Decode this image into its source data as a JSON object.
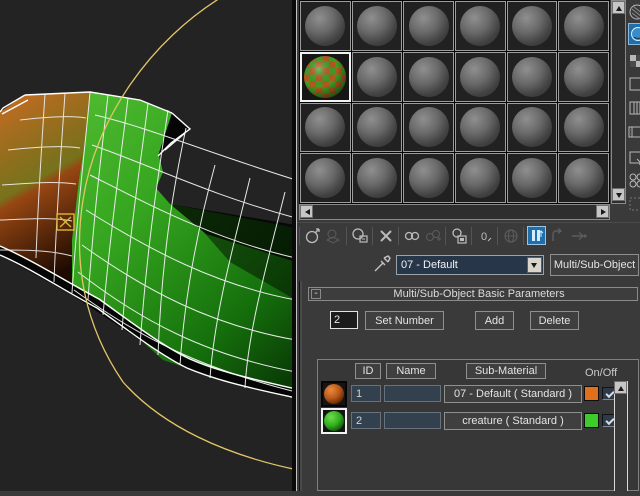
{
  "viewport": {
    "mesh": "creature-limb-mesh",
    "colors": {
      "green_material": "#3fbf28",
      "orange_material": "#c2651e",
      "wireframe": "#f2f2f2",
      "gizmo_yellow": "#e3c568",
      "background": "#232323"
    }
  },
  "material_editor": {
    "slots": {
      "rows": 4,
      "cols": 6,
      "selected_index": 6,
      "selected_slot_name": "multi-sub-object-checker-sphere"
    },
    "side_toolbar": {
      "icons": [
        "sample-type-icon",
        "backlight-icon",
        "background-icon",
        "sample-uv-tiling-icon",
        "video-color-check-icon",
        "make-preview-icon",
        "options-icon",
        "select-by-material-icon",
        "material-map-navigator-icon"
      ],
      "pressed": "backlight-icon",
      "pressed_color": "#1d6fae"
    },
    "toolbar": {
      "icons": [
        {
          "name": "get-material-icon",
          "enabled": true
        },
        {
          "name": "put-material-to-scene-icon",
          "enabled": false
        },
        {
          "name": "assign-material-to-selection-icon",
          "enabled": true
        },
        {
          "name": "reset-map-icon",
          "enabled": true
        },
        {
          "name": "make-material-copy-icon",
          "enabled": true
        },
        {
          "name": "make-unique-icon",
          "enabled": false
        },
        {
          "name": "put-to-library-icon",
          "enabled": true
        },
        {
          "name": "material-id-channel-icon",
          "enabled": true,
          "glyph": "0"
        },
        {
          "name": "show-map-in-viewport-icon",
          "enabled": false
        },
        {
          "name": "show-end-result-icon",
          "enabled": true,
          "pressed": true
        },
        {
          "name": "go-to-parent-icon",
          "enabled": false
        },
        {
          "name": "go-forward-to-sibling-icon",
          "enabled": false
        }
      ]
    },
    "name_row": {
      "picker_icon": "pick-material-from-object-icon",
      "material_name": "07 - Default",
      "type_button_label": "Multi/Sub-Object"
    },
    "rollout": {
      "collapse_glyph": "-",
      "title": "Multi/Sub-Object Basic Parameters"
    },
    "params": {
      "count_value": "2",
      "set_number_label": "Set Number",
      "add_label": "Add",
      "delete_label": "Delete"
    },
    "table": {
      "headers": {
        "id": "ID",
        "name": "Name",
        "sub_material": "Sub-Material",
        "on_off": "On/Off"
      },
      "rows": [
        {
          "id": "1",
          "name": "",
          "sub_material": "07 - Default  ( Standard )",
          "swatch_color": "#e1701d",
          "on": true,
          "preview": "orange-sphere",
          "selected": false
        },
        {
          "id": "2",
          "name": "",
          "sub_material": "creature  ( Standard )",
          "swatch_color": "#3ecc2b",
          "on": true,
          "preview": "green-sphere",
          "selected": true
        }
      ]
    }
  }
}
